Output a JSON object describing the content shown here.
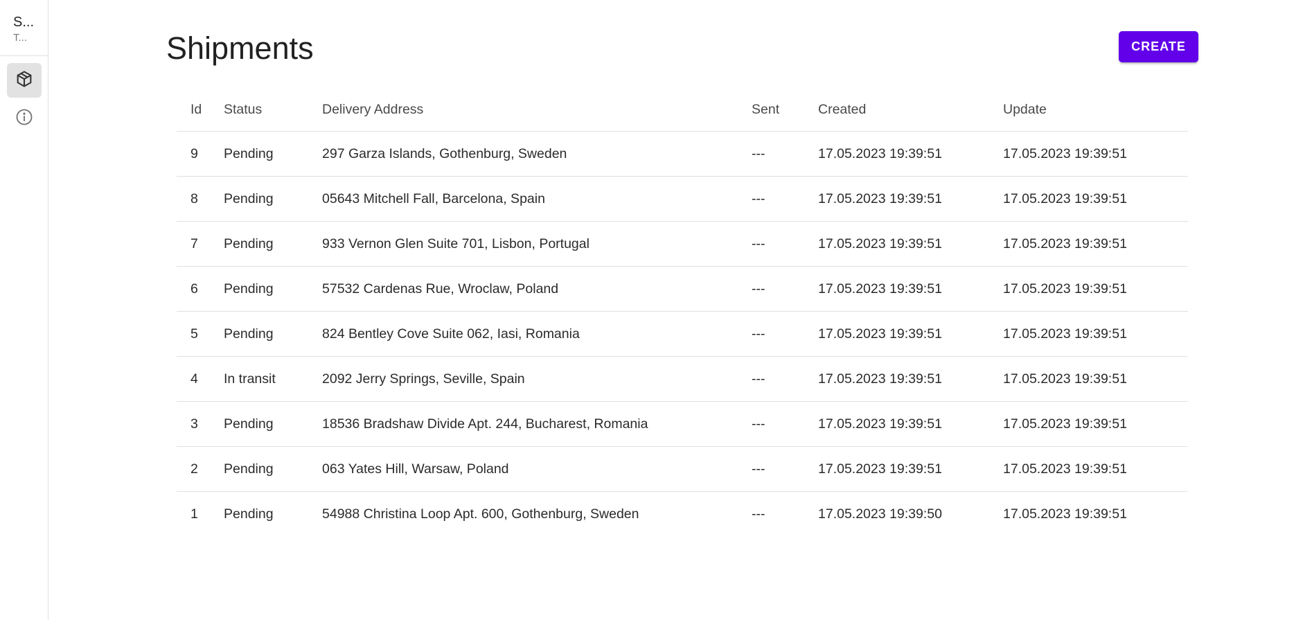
{
  "sidebar": {
    "title": "S...",
    "subtitle": "T...",
    "items": [
      {
        "name": "shipments",
        "icon": "package-icon",
        "active": true
      },
      {
        "name": "info",
        "icon": "info-icon",
        "active": false
      }
    ]
  },
  "header": {
    "title": "Shipments",
    "create_label": "CREATE"
  },
  "colors": {
    "accent": "#6200ea",
    "nav_active_bg": "#e2e2e2",
    "divider": "#e0e0e0"
  },
  "table": {
    "columns": [
      "Id",
      "Status",
      "Delivery Address",
      "Sent",
      "Created",
      "Update"
    ],
    "rows": [
      {
        "id": "9",
        "status": "Pending",
        "address": "297 Garza Islands, Gothenburg, Sweden",
        "sent": "---",
        "created": "17.05.2023 19:39:51",
        "updated": "17.05.2023 19:39:51"
      },
      {
        "id": "8",
        "status": "Pending",
        "address": "05643 Mitchell Fall, Barcelona, Spain",
        "sent": "---",
        "created": "17.05.2023 19:39:51",
        "updated": "17.05.2023 19:39:51"
      },
      {
        "id": "7",
        "status": "Pending",
        "address": "933 Vernon Glen Suite 701, Lisbon, Portugal",
        "sent": "---",
        "created": "17.05.2023 19:39:51",
        "updated": "17.05.2023 19:39:51"
      },
      {
        "id": "6",
        "status": "Pending",
        "address": "57532 Cardenas Rue, Wroclaw, Poland",
        "sent": "---",
        "created": "17.05.2023 19:39:51",
        "updated": "17.05.2023 19:39:51"
      },
      {
        "id": "5",
        "status": "Pending",
        "address": "824 Bentley Cove Suite 062, Iasi, Romania",
        "sent": "---",
        "created": "17.05.2023 19:39:51",
        "updated": "17.05.2023 19:39:51"
      },
      {
        "id": "4",
        "status": "In transit",
        "address": "2092 Jerry Springs, Seville, Spain",
        "sent": "---",
        "created": "17.05.2023 19:39:51",
        "updated": "17.05.2023 19:39:51"
      },
      {
        "id": "3",
        "status": "Pending",
        "address": "18536 Bradshaw Divide Apt. 244, Bucharest, Romania",
        "sent": "---",
        "created": "17.05.2023 19:39:51",
        "updated": "17.05.2023 19:39:51"
      },
      {
        "id": "2",
        "status": "Pending",
        "address": "063 Yates Hill, Warsaw, Poland",
        "sent": "---",
        "created": "17.05.2023 19:39:51",
        "updated": "17.05.2023 19:39:51"
      },
      {
        "id": "1",
        "status": "Pending",
        "address": "54988 Christina Loop Apt. 600, Gothenburg, Sweden",
        "sent": "---",
        "created": "17.05.2023 19:39:50",
        "updated": "17.05.2023 19:39:51"
      }
    ]
  }
}
